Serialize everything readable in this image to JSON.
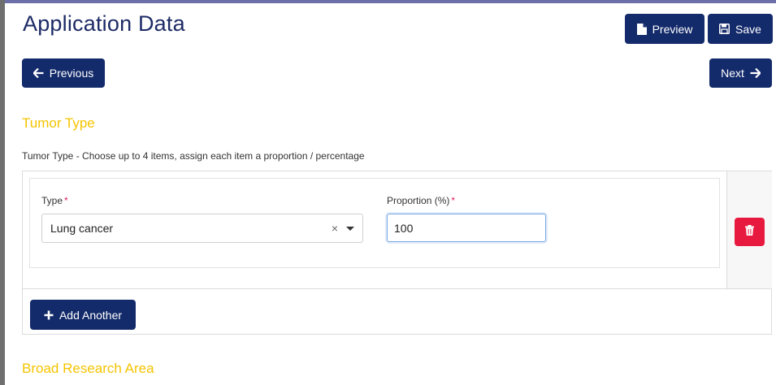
{
  "page": {
    "title": "Application Data"
  },
  "toolbar": {
    "preview_label": "Preview",
    "save_label": "Save"
  },
  "nav": {
    "previous_label": "Previous",
    "next_label": "Next"
  },
  "tumor": {
    "section_title": "Tumor Type",
    "hint": "Tumor Type - Choose up to 4 items, assign each item a proportion / percentage",
    "type_label": "Type",
    "proportion_label": "Proportion (%)",
    "required_mark": "*",
    "selected_type": "Lung cancer",
    "clear_symbol": "×",
    "proportion_value": "100",
    "add_label": "Add Another"
  },
  "broad": {
    "section_title": "Broad Research Area"
  },
  "icons": {
    "preview": "file-icon",
    "save": "floppy-disk-icon",
    "previous": "arrow-left-icon",
    "next": "arrow-right-icon",
    "delete": "trash-icon",
    "add": "plus-icon",
    "dropdown": "caret-down-icon"
  },
  "colors": {
    "primary": "#132a6b",
    "title": "#1d2b66",
    "section": "#f5c400",
    "danger": "#e8193f",
    "required": "#e0245e"
  }
}
